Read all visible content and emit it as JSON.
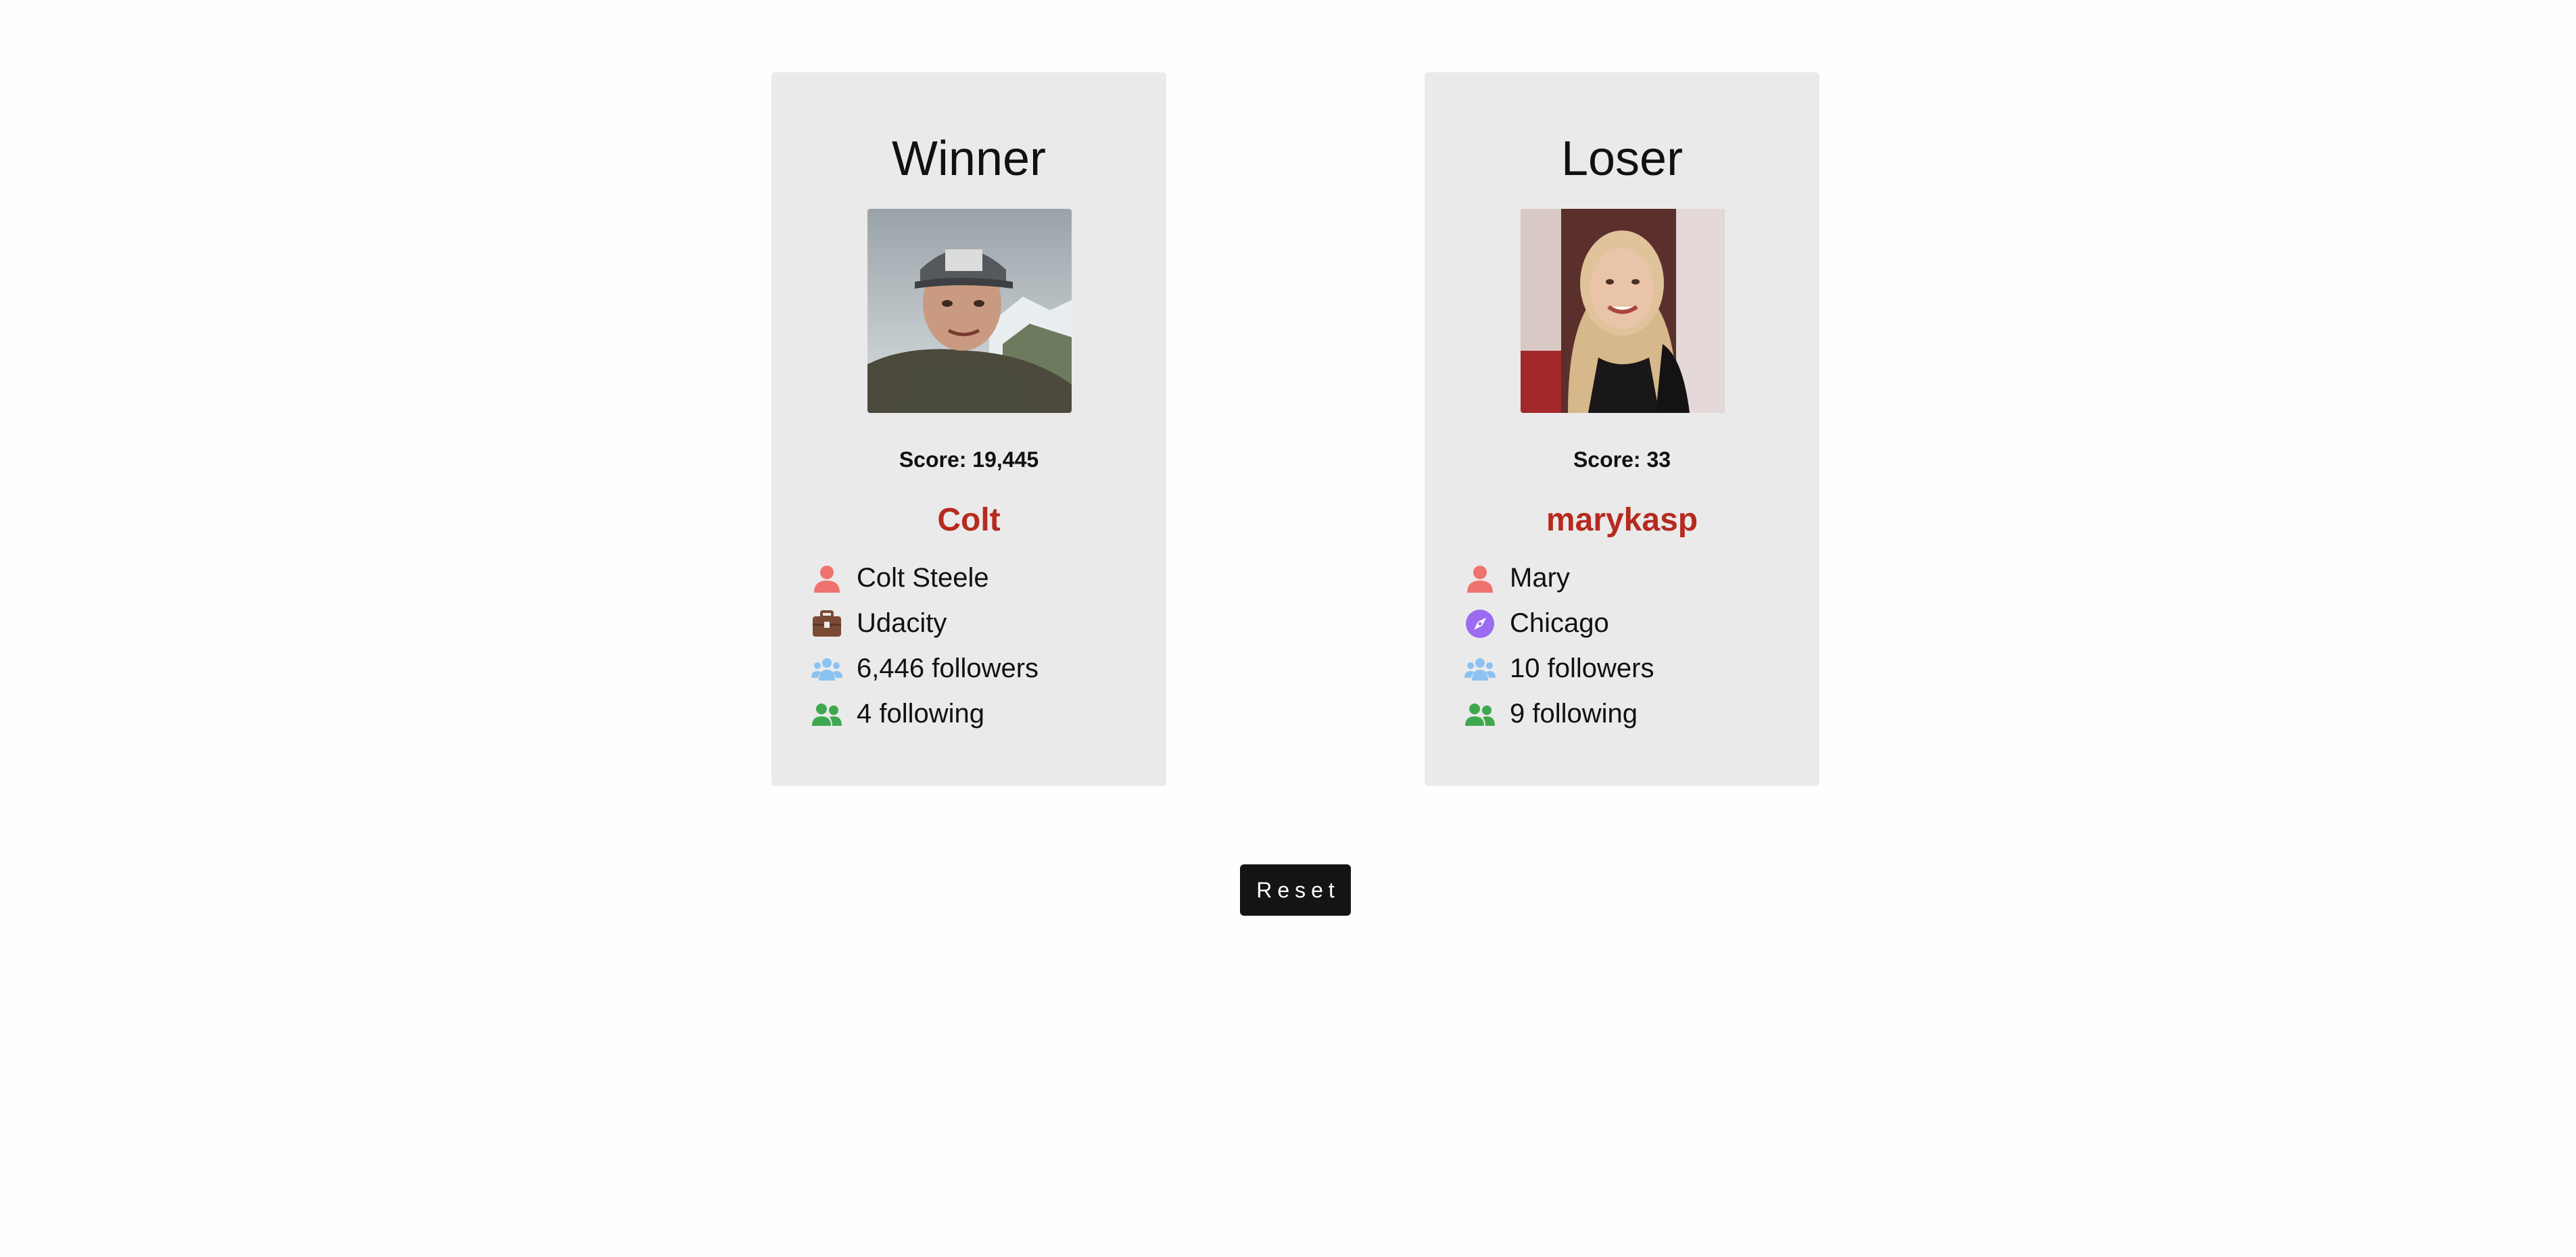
{
  "players": {
    "winner": {
      "heading": "Winner",
      "score_label": "Score: 19,445",
      "username": "Colt",
      "name": "Colt Steele",
      "company": "Udacity",
      "followers": "6,446 followers",
      "following": "4 following"
    },
    "loser": {
      "heading": "Loser",
      "score_label": "Score: 33",
      "username": "marykasp",
      "name": "Mary",
      "location": "Chicago",
      "followers": "10 followers",
      "following": "9 following"
    }
  },
  "actions": {
    "reset_label": "Reset"
  },
  "icons": {
    "user": "user-icon",
    "company": "briefcase-icon",
    "location": "compass-icon",
    "followers": "users-icon",
    "following": "user-friends-icon"
  },
  "colors": {
    "username": "#b62a1f",
    "user_icon": "#f0726e",
    "briefcase_icon": "#7a4a35",
    "compass_icon": "#9b6cf2",
    "followers_icon": "#8cc2f2",
    "following_icon": "#3fa84e",
    "card_bg": "#eaeaea",
    "button_bg": "#141414"
  }
}
